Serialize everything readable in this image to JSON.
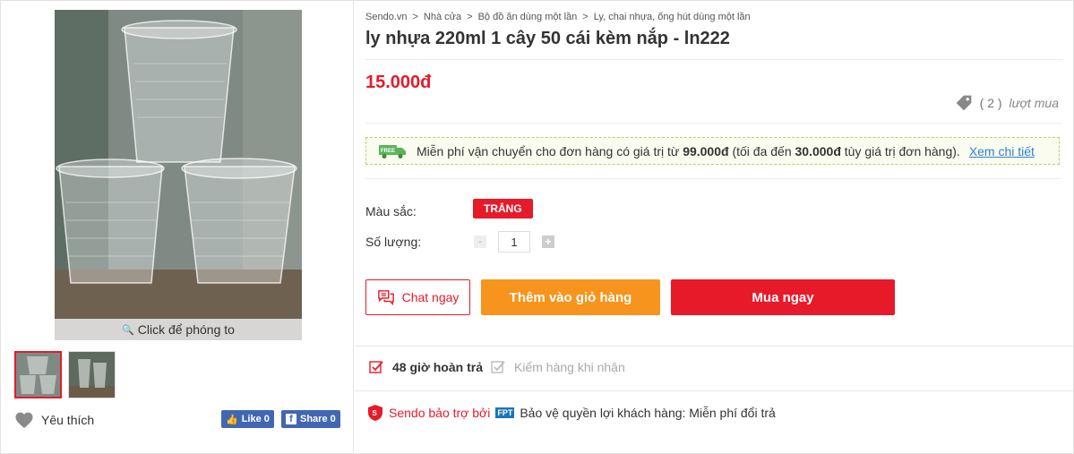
{
  "gallery": {
    "zoom_label": "Click để phóng to"
  },
  "favorite_label": "Yêu thích",
  "social": {
    "like_label": "Like 0",
    "share_label": "Share 0"
  },
  "breadcrumb": [
    "Sendo.vn",
    "Nhà cửa",
    "Bộ đồ ăn dùng một lần",
    "Ly, chai nhựa, ống hút dùng một lần"
  ],
  "product": {
    "title": "ly nhựa 220ml 1 cây 50 cái kèm nắp - ln222",
    "price": "15.000đ",
    "sold_count": "( 2 )",
    "sold_label": "lượt mua"
  },
  "shipping": {
    "badge": "FREE",
    "text_before": "Miễn phí vận chuyển cho đơn hàng có giá trị từ",
    "min_amount": "99.000đ",
    "text_mid": "(tối đa đến",
    "max_amount": "30.000đ",
    "text_after": "tùy giá trị đơn hàng).",
    "link": "Xem chi tiết"
  },
  "options": {
    "color_label": "Màu sắc:",
    "color_value": "TRẮNG",
    "qty_label": "Số lượng:",
    "qty_value": "1",
    "minus": "-",
    "plus": "+"
  },
  "actions": {
    "chat": "Chat ngay",
    "add_to_cart": "Thêm vào giỏ hàng",
    "buy_now": "Mua ngay"
  },
  "policies": {
    "return": "48 giờ hoàn trả",
    "inspect": "Kiểm hàng khi nhận"
  },
  "sponsor": {
    "label": "Sendo bảo trợ bởi",
    "logo": "FPT",
    "text": "Bảo vệ quyền lợi khách hàng: Miễn phí đổi trả"
  },
  "colors": {
    "brand_red": "#e71a2a",
    "cart_orange": "#f7941d",
    "link_blue": "#2f80d1",
    "facebook_blue": "#4267b2"
  }
}
